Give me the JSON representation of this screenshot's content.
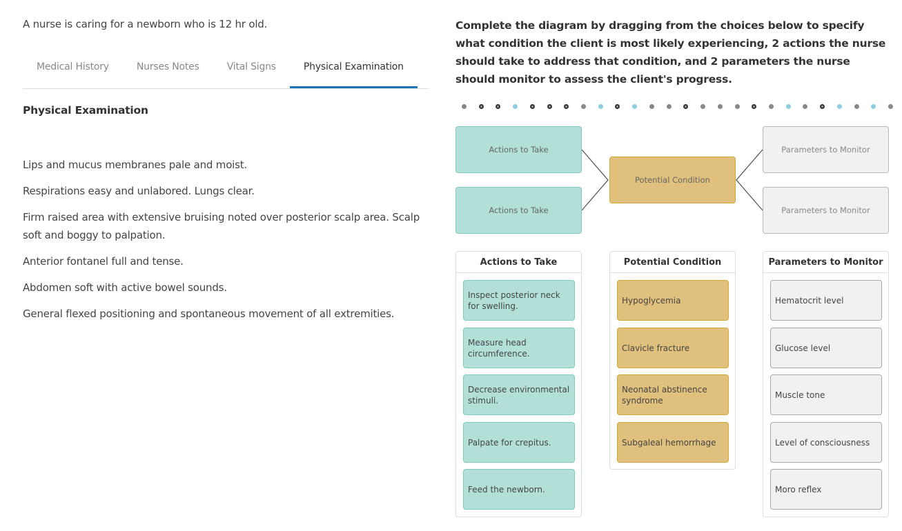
{
  "scenario": "A nurse is caring for a newborn who is 12 hr old.",
  "tabs": [
    {
      "label": "Medical History",
      "active": false
    },
    {
      "label": "Nurses Notes",
      "active": false
    },
    {
      "label": "Vital Signs",
      "active": false
    },
    {
      "label": "Physical Examination",
      "active": true
    }
  ],
  "section_title": "Physical Examination",
  "findings": [
    "Lips and mucus membranes pale and moist.",
    "Respirations easy and unlabored. Lungs clear.",
    "Firm raised area with extensive bruising noted over posterior scalp area. Scalp soft and boggy to palpation.",
    "Anterior fontanel full and tense.",
    "Abdomen soft with active bowel sounds.",
    "General flexed positioning and spontaneous movement of all extremities."
  ],
  "instructions": "Complete the diagram by dragging from the choices below to specify what condition the client is most likely experiencing, 2 actions the nurse should take to address that condition, and 2 parameters the nurse should monitor to assess the client's progress.",
  "progress_dots": [
    "gray",
    "ring",
    "ring",
    "blue",
    "ring",
    "ring",
    "ring",
    "gray",
    "blue",
    "ring",
    "blue",
    "gray",
    "gray",
    "ring",
    "gray",
    "gray",
    "gray",
    "ring",
    "gray",
    "blue",
    "gray",
    "ring",
    "blue",
    "gray",
    "blue",
    "gray"
  ],
  "diagram": {
    "action_slot_1": "Actions to Take",
    "action_slot_2": "Actions to Take",
    "condition_slot": "Potential Condition",
    "param_slot_1": "Parameters to Monitor",
    "param_slot_2": "Parameters to Monitor"
  },
  "banks": {
    "actions": {
      "title": "Actions to Take",
      "items": [
        "Inspect posterior neck for swelling.",
        "Measure head circumference.",
        "Decrease environmental stimuli.",
        "Palpate for crepitus.",
        "Feed the newborn."
      ]
    },
    "conditions": {
      "title": "Potential Condition",
      "items": [
        "Hypoglycemia",
        "Clavicle fracture",
        "Neonatal abstinence syndrome",
        "Subgaleal hemorrhage"
      ]
    },
    "parameters": {
      "title": "Parameters to Monitor",
      "items": [
        "Hematocrit level",
        "Glucose level",
        "Muscle tone",
        "Level of consciousness",
        "Moro reflex"
      ]
    }
  },
  "colors": {
    "active_tab": "#1874b8",
    "action": "#b2e0d9",
    "condition": "#dfc17d",
    "parameter": "#f1f1f1",
    "dot_blue": "#8fcce0"
  }
}
